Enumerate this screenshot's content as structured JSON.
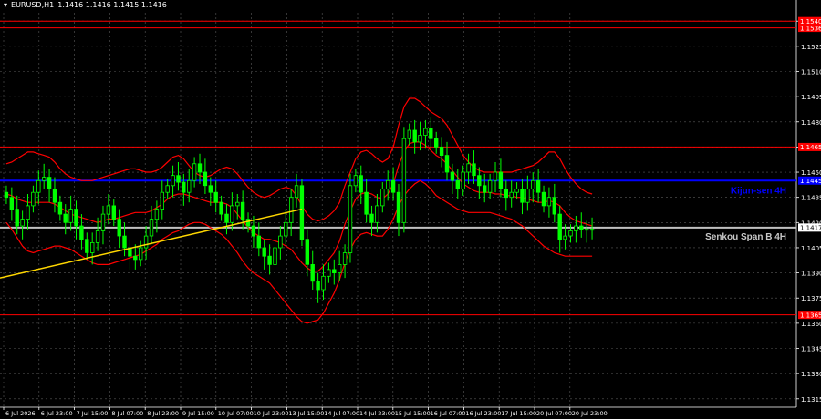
{
  "header": {
    "symbol": "EURUSD,H1",
    "ohlc": "1.1416 1.1416 1.1415 1.1416"
  },
  "colors": {
    "background": "#000000",
    "grid": "#5a5a5a",
    "bull_candle": "#00ff00",
    "bear_candle": "#00ff00",
    "bollinger": "#ff0000",
    "trendline": "#ffd700",
    "kijun": "#0000ff",
    "senkou": "#c0c0c0",
    "level": "#ff0000",
    "axis_text": "#ffffff"
  },
  "chart_data": {
    "type": "candlestick",
    "ylim": [
      1.131,
      1.1545
    ],
    "y_ticks": [
      "1.1540",
      "1.1525",
      "1.1510",
      "1.1495",
      "1.1480",
      "1.1465",
      "1.1450",
      "1.1435",
      "1.1420",
      "1.1405",
      "1.1390",
      "1.1375",
      "1.1360",
      "1.1345",
      "1.1330",
      "1.1315"
    ],
    "x_labels": [
      "6 Jul 2026",
      "6 Jul 23:00",
      "7 Jul 15:00",
      "8 Jul 07:00",
      "8 Jul 23:00",
      "9 Jul 15:00",
      "10 Jul 07:00",
      "10 Jul 23:00",
      "13 Jul 15:00",
      "14 Jul 07:00",
      "14 Jul 23:00",
      "15 Jul 15:00",
      "16 Jul 07:00",
      "16 Jul 23:00",
      "17 Jul 15:00",
      "20 Jul 07:00",
      "20 Jul 23:00"
    ],
    "bars_total": 110,
    "levels": [
      {
        "price": 1.154,
        "label": "1.1540",
        "color": "#ff0000"
      },
      {
        "price": 1.1536,
        "label": "1.1536",
        "color": "#ff0000"
      },
      {
        "price": 1.1465,
        "label": "1.1465",
        "color": "#ff0000"
      },
      {
        "price": 1.1365,
        "label": "1.1365",
        "color": "#ff0000"
      }
    ],
    "kijun": {
      "price": 1.1445,
      "label": "Kijun-sen 4H",
      "price_label": "1.1445"
    },
    "senkou": {
      "price": 1.1417,
      "label": "Senkou Span B 4H",
      "price_label": "1.1417"
    },
    "trendline": {
      "from": [
        0,
        1.1387
      ],
      "to": [
        55,
        1.1428
      ]
    },
    "closes": [
      1.1435,
      1.1428,
      1.1418,
      1.1422,
      1.143,
      1.1438,
      1.1445,
      1.1447,
      1.144,
      1.1432,
      1.1425,
      1.142,
      1.1428,
      1.1418,
      1.141,
      1.1402,
      1.1408,
      1.1415,
      1.1425,
      1.143,
      1.1422,
      1.1412,
      1.1405,
      1.14,
      1.1398,
      1.1405,
      1.1412,
      1.1422,
      1.1428,
      1.1438,
      1.1442,
      1.1448,
      1.1444,
      1.1438,
      1.1445,
      1.1455,
      1.145,
      1.1442,
      1.1438,
      1.1432,
      1.1425,
      1.142,
      1.143,
      1.1432,
      1.1422,
      1.1418,
      1.1412,
      1.1405,
      1.14,
      1.1395,
      1.1405,
      1.1412,
      1.142,
      1.1435,
      1.1442,
      1.141,
      1.1395,
      1.1385,
      1.138,
      1.1388,
      1.1392,
      1.139,
      1.1395,
      1.1402,
      1.1442,
      1.1448,
      1.1438,
      1.1425,
      1.142,
      1.143,
      1.144,
      1.1445,
      1.1438,
      1.142,
      1.147,
      1.1475,
      1.1468,
      1.1472,
      1.1476,
      1.147,
      1.1465,
      1.146,
      1.145,
      1.1445,
      1.144,
      1.145,
      1.1455,
      1.1448,
      1.1442,
      1.1438,
      1.1445,
      1.145,
      1.144,
      1.1435,
      1.1438,
      1.144,
      1.1432,
      1.144,
      1.1445,
      1.1438,
      1.143,
      1.1435,
      1.1425,
      1.141,
      1.1412,
      1.1415,
      1.1418,
      1.1416,
      1.1416,
      1.1416
    ],
    "bb_upper": [
      1.1455,
      1.1456,
      1.1458,
      1.146,
      1.1462,
      1.1462,
      1.1461,
      1.146,
      1.1459,
      1.1456,
      1.1452,
      1.1449,
      1.1447,
      1.1446,
      1.1445,
      1.1445,
      1.1445,
      1.1446,
      1.1447,
      1.1448,
      1.1449,
      1.145,
      1.1451,
      1.1452,
      1.1452,
      1.1451,
      1.145,
      1.145,
      1.1451,
      1.1453,
      1.1456,
      1.1459,
      1.146,
      1.1458,
      1.1454,
      1.145,
      1.1448,
      1.1447,
      1.1448,
      1.145,
      1.1452,
      1.1453,
      1.1452,
      1.1449,
      1.1445,
      1.1441,
      1.1438,
      1.1436,
      1.1435,
      1.1436,
      1.1438,
      1.144,
      1.1441,
      1.144,
      1.1436,
      1.143,
      1.1425,
      1.1422,
      1.1421,
      1.1422,
      1.1424,
      1.1427,
      1.1432,
      1.1442,
      1.145,
      1.1458,
      1.1462,
      1.1463,
      1.1461,
      1.1458,
      1.1456,
      1.1458,
      1.1465,
      1.1478,
      1.1489,
      1.1494,
      1.1494,
      1.1492,
      1.1489,
      1.1486,
      1.1484,
      1.1482,
      1.1478,
      1.1472,
      1.1466,
      1.146,
      1.1456,
      1.1453,
      1.1451,
      1.145,
      1.145,
      1.145,
      1.145,
      1.145,
      1.145,
      1.1451,
      1.1452,
      1.1453,
      1.1454,
      1.1456,
      1.1459,
      1.1462,
      1.1462,
      1.1458,
      1.1452,
      1.1447,
      1.1443,
      1.144,
      1.1438,
      1.1437
    ],
    "bb_lower": [
      1.142,
      1.1416,
      1.1411,
      1.1406,
      1.1403,
      1.1402,
      1.1403,
      1.1404,
      1.1405,
      1.1406,
      1.1406,
      1.1405,
      1.1404,
      1.1402,
      1.14,
      1.1398,
      1.1396,
      1.1395,
      1.1395,
      1.1395,
      1.1396,
      1.1397,
      1.1398,
      1.1399,
      1.14,
      1.1401,
      1.1403,
      1.1405,
      1.1407,
      1.141,
      1.1412,
      1.1414,
      1.1415,
      1.1417,
      1.1419,
      1.142,
      1.142,
      1.1419,
      1.1417,
      1.1415,
      1.1413,
      1.141,
      1.1406,
      1.1402,
      1.1397,
      1.1393,
      1.139,
      1.1388,
      1.1386,
      1.1384,
      1.138,
      1.1376,
      1.1372,
      1.1368,
      1.1364,
      1.1361,
      1.136,
      1.1361,
      1.1362,
      1.1366,
      1.1372,
      1.1378,
      1.1386,
      1.1396,
      1.1404,
      1.141,
      1.1413,
      1.1414,
      1.1413,
      1.1412,
      1.1412,
      1.1416,
      1.1422,
      1.143,
      1.1436,
      1.144,
      1.1443,
      1.1445,
      1.1443,
      1.144,
      1.1436,
      1.1434,
      1.1432,
      1.143,
      1.1428,
      1.1427,
      1.1426,
      1.1426,
      1.1426,
      1.1426,
      1.1426,
      1.1425,
      1.1424,
      1.1423,
      1.1422,
      1.142,
      1.1418,
      1.1415,
      1.1412,
      1.1409,
      1.1406,
      1.1404,
      1.1402,
      1.1401,
      1.14,
      1.14,
      1.14,
      1.14,
      1.14,
      1.14
    ],
    "bb_mid": [
      1.1437,
      1.1436,
      1.1434,
      1.1433,
      1.1432,
      1.1432,
      1.1432,
      1.1432,
      1.1432,
      1.1431,
      1.1429,
      1.1427,
      1.1425,
      1.1424,
      1.1423,
      1.1422,
      1.1421,
      1.142,
      1.1421,
      1.1422,
      1.1422,
      1.1423,
      1.1424,
      1.1425,
      1.1426,
      1.1426,
      1.1426,
      1.1427,
      1.1429,
      1.1431,
      1.1434,
      1.1436,
      1.1437,
      1.1437,
      1.1436,
      1.1435,
      1.1434,
      1.1433,
      1.1432,
      1.1432,
      1.1432,
      1.1431,
      1.1429,
      1.1425,
      1.1421,
      1.1417,
      1.1414,
      1.1412,
      1.141,
      1.141,
      1.1409,
      1.1408,
      1.1406,
      1.1404,
      1.14,
      1.1396,
      1.1393,
      1.1391,
      1.1391,
      1.1394,
      1.1398,
      1.1402,
      1.1409,
      1.1419,
      1.1427,
      1.1434,
      1.1437,
      1.1438,
      1.1437,
      1.1435,
      1.1434,
      1.1437,
      1.1443,
      1.1454,
      1.1462,
      1.1467,
      1.1468,
      1.1468,
      1.1466,
      1.1463,
      1.146,
      1.1458,
      1.1455,
      1.1451,
      1.1447,
      1.1443,
      1.1441,
      1.1439,
      1.1438,
      1.1438,
      1.1438,
      1.1437,
      1.1437,
      1.1436,
      1.1436,
      1.1435,
      1.1435,
      1.1434,
      1.1433,
      1.1432,
      1.1432,
      1.1433,
      1.1432,
      1.143,
      1.1426,
      1.1423,
      1.1421,
      1.142,
      1.1419,
      1.1418
    ]
  }
}
